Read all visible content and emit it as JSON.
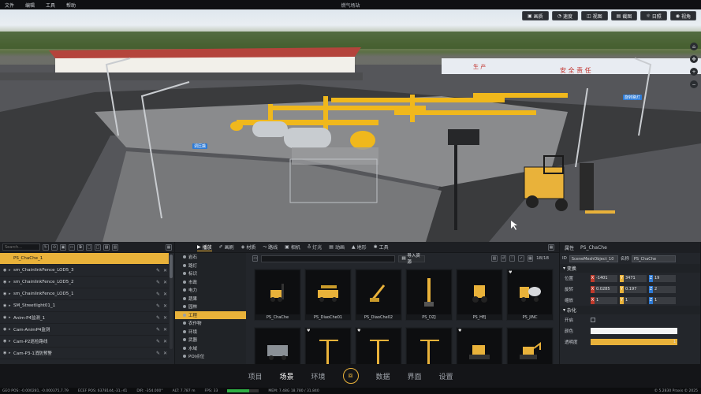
{
  "menubar": {
    "items": [
      "文件",
      "编辑",
      "工具",
      "帮助"
    ],
    "title": "燃气场站"
  },
  "scene": {
    "top_buttons": [
      {
        "label": "画质",
        "icon": "image-icon"
      },
      {
        "label": "速度",
        "icon": "speed-icon"
      },
      {
        "label": "视图",
        "icon": "view-icon"
      },
      {
        "label": "截图",
        "icon": "screenshot-icon"
      },
      {
        "label": "日照",
        "icon": "sun-icon"
      },
      {
        "label": "视角",
        "icon": "camera-icon"
      }
    ],
    "side_buttons": [
      "⌂",
      "✥",
      "+",
      "−"
    ],
    "labels": [
      "调压撬",
      "旋转路灯"
    ],
    "wall_text": "安 全 责 任",
    "wall_text2": "生 产"
  },
  "outliner": {
    "search_placeholder": "Search...",
    "items": [
      {
        "name": "PS_ChaChe_1",
        "selected": true
      },
      {
        "name": "sm_ChainlinkFence_LOD5_3"
      },
      {
        "name": "sm_ChainlinkFence_LOD5_2"
      },
      {
        "name": "sm_ChainlinkFence_LOD5_1"
      },
      {
        "name": "SM_Streetlight01_1"
      },
      {
        "name": "Anim-P4监测_1"
      },
      {
        "name": "Cam-AnimP4监测"
      },
      {
        "name": "Cam-P2巡检路线"
      },
      {
        "name": "Cam-P3-1消防预警"
      }
    ]
  },
  "assets": {
    "tabs": [
      {
        "label": "播放",
        "active": true
      },
      {
        "label": "画刷"
      },
      {
        "label": "材质"
      },
      {
        "label": "路线"
      },
      {
        "label": "相机"
      },
      {
        "label": "灯光"
      },
      {
        "label": "动画"
      },
      {
        "label": "地形"
      },
      {
        "label": "工具"
      }
    ],
    "categories": [
      {
        "label": "岩石"
      },
      {
        "label": "路灯"
      },
      {
        "label": "标识"
      },
      {
        "label": "市政"
      },
      {
        "label": "电力"
      },
      {
        "label": "蔬果"
      },
      {
        "label": "园林"
      },
      {
        "label": "工程",
        "selected": true
      },
      {
        "label": "农作物"
      },
      {
        "label": "环境"
      },
      {
        "label": "武器"
      },
      {
        "label": "水域"
      },
      {
        "label": "POI点位"
      }
    ],
    "import_label": "导入资源",
    "count": "18/18",
    "items": [
      {
        "label": "PS_ChaChe",
        "icon": "forklift-icon",
        "color": "#e9b23a"
      },
      {
        "label": "PS_DiaoChe01",
        "icon": "crane-truck-icon",
        "color": "#e9b23a"
      },
      {
        "label": "PS_DiaoChe02",
        "icon": "crane-icon",
        "color": "#e9b23a"
      },
      {
        "label": "PS_DZJ",
        "icon": "pile-driver-icon",
        "color": "#e9b23a"
      },
      {
        "label": "PS_HEJ",
        "icon": "wheel-loader-icon",
        "color": "#e9b23a"
      },
      {
        "label": "PS_JINC",
        "icon": "mixer-truck-icon",
        "color": "#e9b23a"
      },
      {
        "label": "",
        "icon": "truck-icon",
        "color": "#8a9096"
      },
      {
        "label": "",
        "icon": "tower-crane-icon",
        "color": "#e9b23a"
      },
      {
        "label": "",
        "icon": "tower-crane-icon",
        "color": "#e9b23a"
      },
      {
        "label": "",
        "icon": "tower-crane-icon",
        "color": "#e9b23a"
      },
      {
        "label": "",
        "icon": "bulldozer-icon",
        "color": "#e9b23a"
      },
      {
        "label": "",
        "icon": "excavator-icon",
        "color": "#e9b23a"
      }
    ]
  },
  "properties": {
    "header": "属性",
    "selected_name": "PS_ChaChe",
    "id_label": "ID",
    "id_value": "SceneMeshObject_10",
    "name_label": "名称",
    "name_value": "PS_ChaChe",
    "transform_section": "变换",
    "rows": [
      {
        "label": "位置",
        "x": "-1401",
        "y": "3471",
        "z": "19"
      },
      {
        "label": "旋转",
        "x": "0.0285",
        "y": "0.197",
        "z": "2"
      },
      {
        "label": "缩放",
        "x": "1",
        "y": "1",
        "z": "1"
      }
    ],
    "misc_section": "杂化",
    "enable_label": "开启",
    "color_label": "颜色",
    "opacity_label": "透明度",
    "opacity_value": "1",
    "opacity_fraction": 1.0
  },
  "bottomnav": {
    "items": [
      "项目",
      "场景",
      "环境",
      "",
      "数据",
      "界面",
      "设置"
    ],
    "active": "场景",
    "logo": "⧈"
  },
  "status": {
    "geo": "GEO POS: -0.000281, -0.000375,7.79",
    "ecef": "ECEF POS: 6378144,-31,-41",
    "dir": "DIR: -354.000°",
    "alt": "ALT: 7.787 m",
    "fps": "FPS: 33",
    "mem": "MEM: 7.48G 18.780 / 31.840",
    "right": "© 5.2830  Praxis © 2025"
  },
  "colors": {
    "accent": "#e9b23a",
    "panel": "#23262b",
    "blue": "#2e7bd6"
  }
}
